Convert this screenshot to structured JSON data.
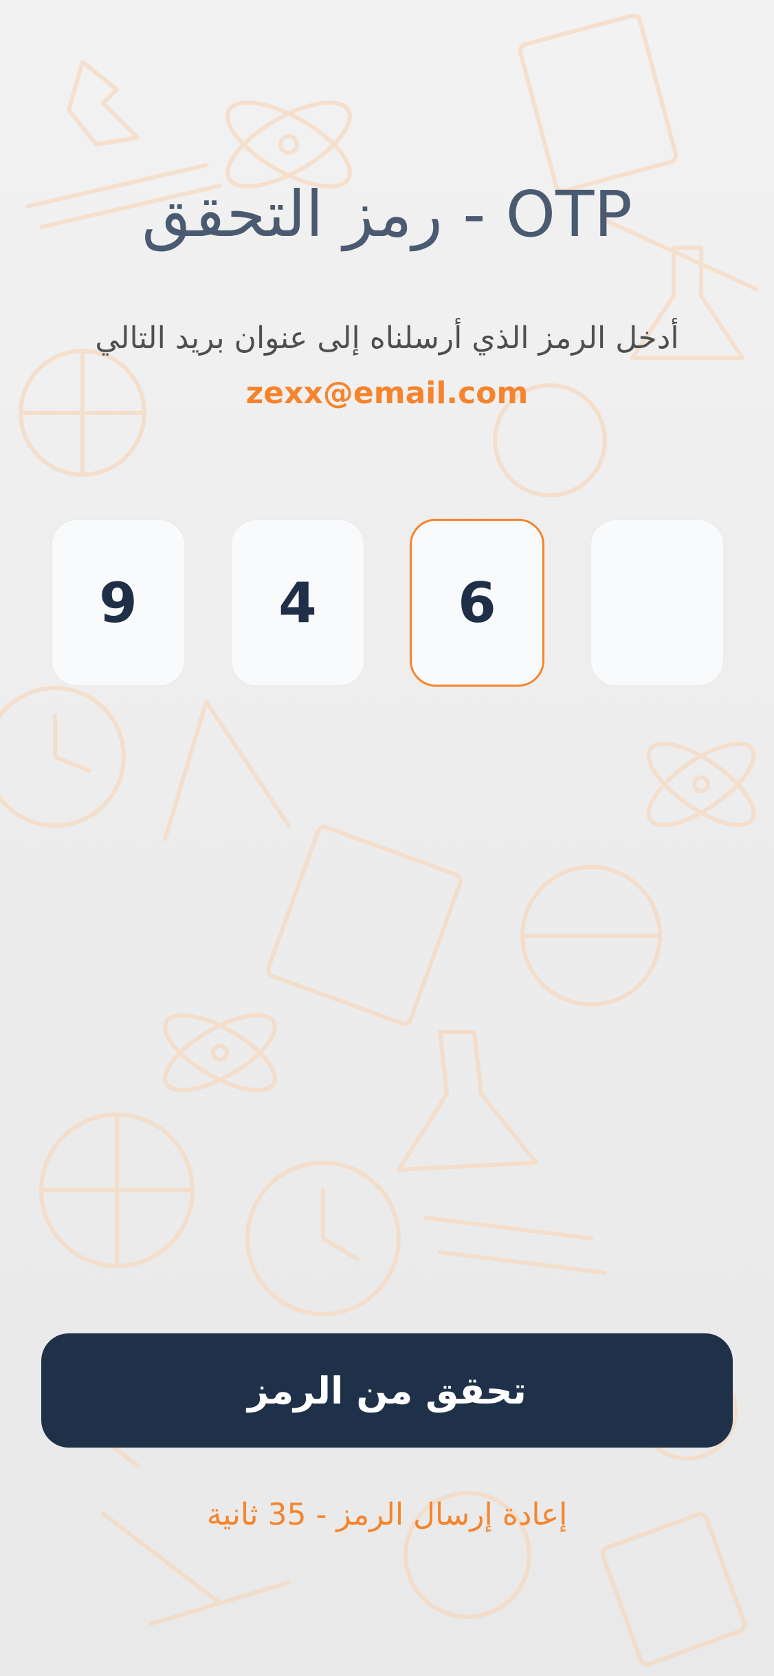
{
  "header": {
    "title": "رمز التحقق - OTP"
  },
  "instructions": {
    "text": "أدخل الرمز الذي أرسلناه إلى عنوان بريد التالي",
    "email": "zexx@email.com"
  },
  "otp": {
    "digits": [
      "9",
      "4",
      "6",
      ""
    ],
    "active_index": 2
  },
  "actions": {
    "verify_label": "تحقق من الرمز",
    "resend_label": "إعادة إرسال الرمز - 35 ثانية"
  },
  "colors": {
    "accent": "#f5842c",
    "primary": "#1f3049",
    "title": "#4a5a70",
    "background": "#ededed"
  }
}
